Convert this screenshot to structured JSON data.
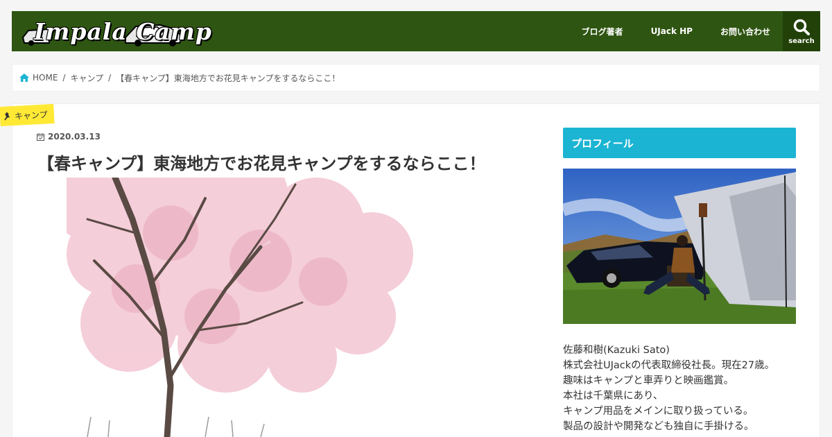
{
  "header": {
    "logo_text": "Impala Camp",
    "nav": [
      {
        "label": "ブログ著者"
      },
      {
        "label": "UJack HP"
      },
      {
        "label": "お問い合わせ"
      }
    ],
    "search_label": "search"
  },
  "breadcrumb": {
    "home": "HOME",
    "category": "キャンプ",
    "current": "【春キャンプ】東海地方でお花見キャンプをするならここ！"
  },
  "post": {
    "category": "キャンプ",
    "date": "2020.03.13",
    "title": "【春キャンプ】東海地方でお花見キャンプをするならここ！"
  },
  "sidebar": {
    "heading": "プロフィール",
    "profile_lines": [
      "佐藤和樹(Kazuki Sato)",
      "株式会社UJackの代表取締役社長。現在27歳。",
      "趣味はキャンプと車弄りと映画鑑賞。",
      "本社は千葉県にあり、",
      "キャンプ用品をメインに取り扱っている。",
      "製品の設計や開発なども独自に手掛ける。"
    ]
  },
  "colors": {
    "header_bg": "#2e5512",
    "accent": "#1bb4d3",
    "category_label": "#ffe935"
  }
}
